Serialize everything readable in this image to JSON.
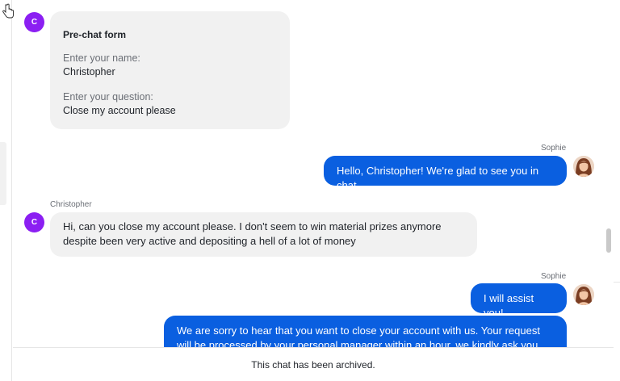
{
  "avatar_initial": "C",
  "prechat": {
    "title": "Pre-chat form",
    "name_label": "Enter your name:",
    "name_value": "Christopher",
    "question_label": "Enter your question:",
    "question_value": "Close my account please"
  },
  "messages": [
    {
      "sender": "Sophie",
      "text": "Hello, Christopher! We're glad to see you in chat."
    },
    {
      "sender": "Christopher",
      "text": "Hi, can you close my account please. I don't seem to win material prizes anymore despite been very active and depositing a hell of a lot of money"
    },
    {
      "sender": "Sophie",
      "text": "I will assist you!"
    },
    {
      "sender": "Sophie",
      "text": "We are sorry to hear that you want to close your account with us. Your request will be processed by your personal manager within an hour, we kindly ask you not to play"
    }
  ],
  "footer": {
    "status": "This chat has been archived."
  },
  "colors": {
    "accent": "#0a5fe0",
    "avatar": "#8b1ff2",
    "bubble_in": "#f1f1f1"
  }
}
